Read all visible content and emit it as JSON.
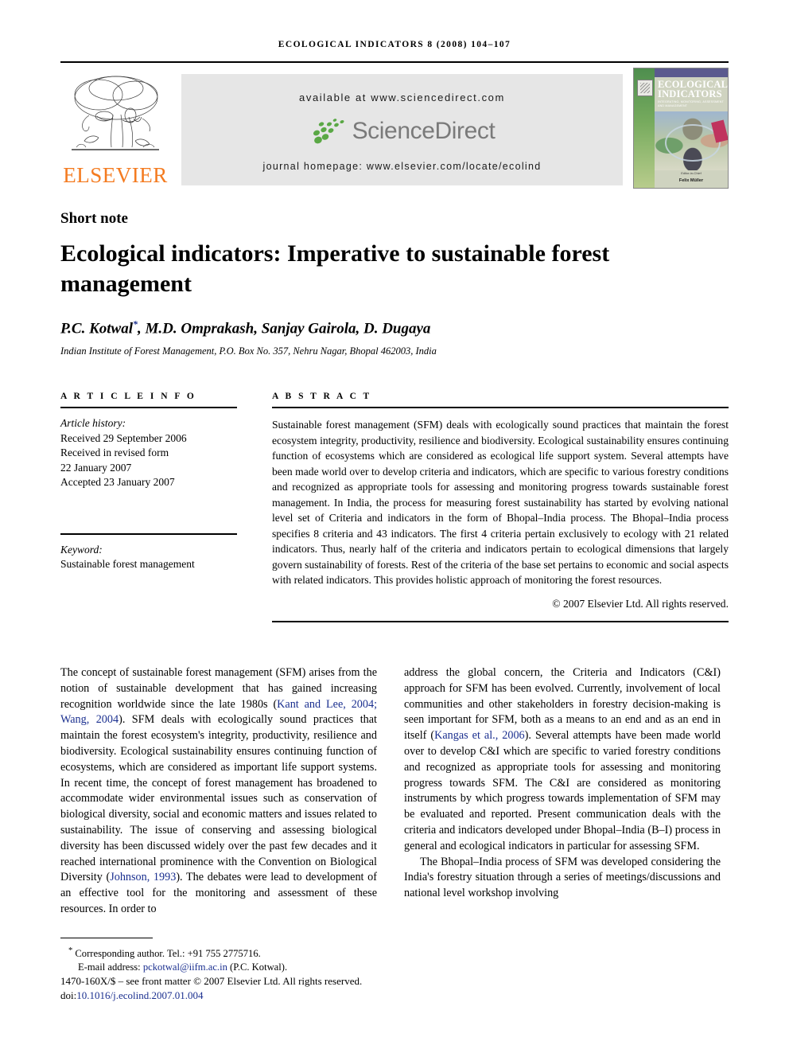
{
  "running_head": "ECOLOGICAL INDICATORS 8 (2008) 104–107",
  "masthead": {
    "elsevier_wordmark": "ELSEVIER",
    "available_at": "available at www.sciencedirect.com",
    "sciencedirect_wordmark": "ScienceDirect",
    "journal_homepage": "journal homepage: www.elsevier.com/locate/ecolind",
    "cover": {
      "title_line1": "ECOLOGICAL",
      "title_line2": "INDICATORS",
      "subtitle": "INTEGRATING, MONITORING, ASSESSMENT AND MANAGEMENT",
      "editor_label": "Editor-in-Chief",
      "editor_name": "Felix Müller"
    }
  },
  "article": {
    "type_label": "Short note",
    "title": "Ecological indicators: Imperative to sustainable forest management",
    "authors": "P.C. Kotwal",
    "authors_rest": ", M.D. Omprakash, Sanjay Gairola, D. Dugaya",
    "corresponding_marker": "*",
    "affiliation": "Indian Institute of Forest Management, P.O. Box No. 357, Nehru Nagar, Bhopal 462003, India"
  },
  "article_info": {
    "heading": "A R T I C L E   I N F O",
    "history_label": "Article history:",
    "received": "Received 29 September 2006",
    "revised_label": "Received in revised form",
    "revised_date": "22 January 2007",
    "accepted": "Accepted 23 January 2007",
    "keyword_label": "Keyword:",
    "keyword_value": "Sustainable forest management"
  },
  "abstract": {
    "heading": "A B S T R A C T",
    "text": "Sustainable forest management (SFM) deals with ecologically sound practices that maintain the forest ecosystem integrity, productivity, resilience and biodiversity. Ecological sustainability ensures continuing function of ecosystems which are considered as ecological life support system. Several attempts have been made world over to develop criteria and indicators, which are specific to various forestry conditions and recognized as appropriate tools for assessing and monitoring progress towards sustainable forest management. In India, the process for measuring forest sustainability has started by evolving national level set of Criteria and indicators in the form of Bhopal–India process. The Bhopal–India process specifies 8 criteria and 43 indicators. The first 4 criteria pertain exclusively to ecology with 21 related indicators. Thus, nearly half of the criteria and indicators pertain to ecological dimensions that largely govern sustainability of forests. Rest of the criteria of the base set pertains to economic and social aspects with related indicators. This provides holistic approach of monitoring the forest resources.",
    "copyright": "© 2007 Elsevier Ltd. All rights reserved."
  },
  "body": {
    "left_p1_a": "The concept of sustainable forest management (SFM) arises from the notion of sustainable development that has gained increasing recognition worldwide since the late 1980s (",
    "left_cite1": "Kant and Lee, 2004; Wang, 2004",
    "left_p1_b": "). SFM deals with ecologically sound practices that maintain the forest ecosystem's integrity, productivity, resilience and biodiversity. Ecological sustainability ensures continuing function of ecosystems, which are considered as important life support systems. In recent time, the concept of forest management has broadened to accommodate wider environmental issues such as conservation of biological diversity, social and economic matters and issues related to sustainability. The issue of conserving and assessing biological diversity has been discussed widely over the past few decades and it reached international prominence with the Convention on Biological Diversity (",
    "left_cite2": "Johnson, 1993",
    "left_p1_c": "). The debates were lead to development of an effective tool for the monitoring and assessment of these resources. In order to",
    "right_p1_a": "address the global concern, the Criteria and Indicators (C&I) approach for SFM has been evolved. Currently, involvement of local communities and other stakeholders in forestry decision-making is seen important for SFM, both as a means to an end and as an end in itself (",
    "right_cite1": "Kangas et al., 2006",
    "right_p1_b": "). Several attempts have been made world over to develop C&I which are specific to varied forestry conditions and recognized as appropriate tools for assessing and monitoring progress towards SFM. The C&I are considered as monitoring instruments by which progress towards implementation of SFM may be evaluated and reported. Present communication deals with the criteria and indicators developed under Bhopal–India (B–I) process in general and ecological indicators in particular for assessing SFM.",
    "right_p2": "The Bhopal–India process of SFM was developed considering the India's forestry situation through a series of meetings/discussions and national level workshop involving"
  },
  "footnotes": {
    "corresponding_marker": "*",
    "corresponding": "Corresponding author. Tel.: +91 755 2775716.",
    "email_label": "E-mail address:",
    "email": "pckotwal@iifm.ac.in",
    "email_owner": "(P.C. Kotwal).",
    "frontmatter": "1470-160X/$ – see front matter © 2007 Elsevier Ltd. All rights reserved.",
    "doi_label": "doi:",
    "doi": "10.1016/j.ecolind.2007.01.004"
  },
  "colors": {
    "link": "#1a2f8f",
    "elsevier_orange": "#F47B20",
    "sciencedirect_green": "#5aa845",
    "sciencedirect_gray": "#7a7a7a",
    "band_gray": "#e6e6e6"
  }
}
